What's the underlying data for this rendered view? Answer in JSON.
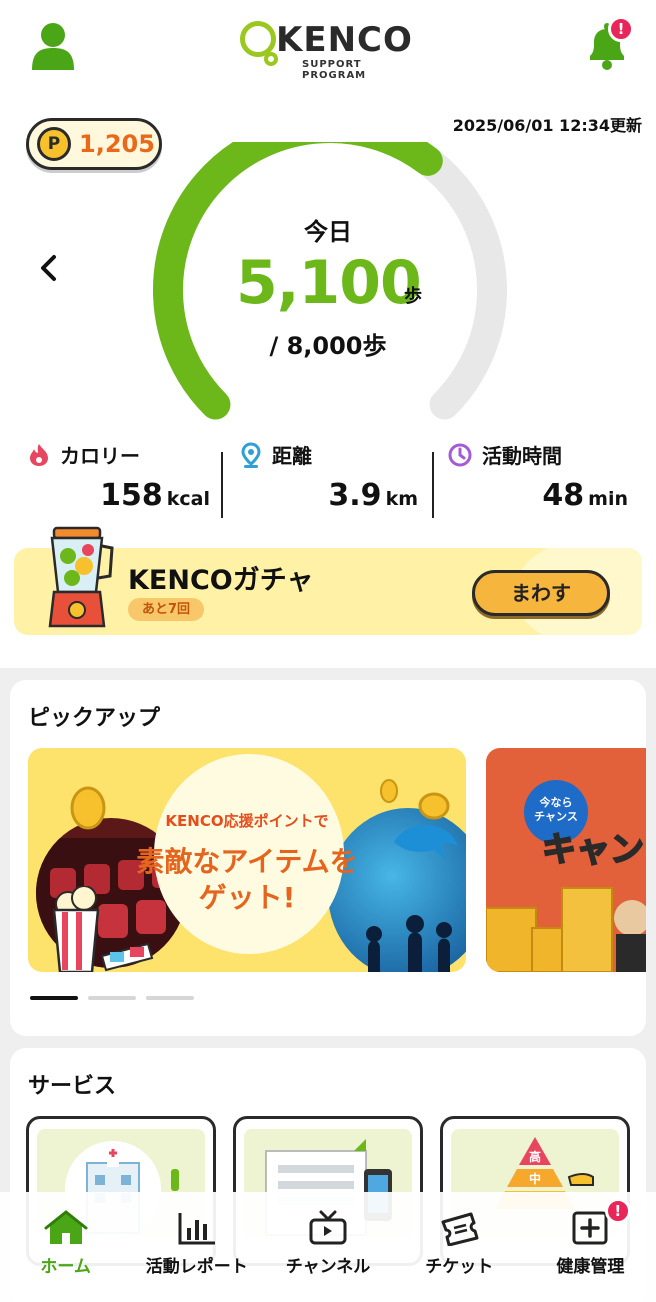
{
  "header": {
    "logo_text": "KENCO",
    "logo_subtitle": "SUPPORT PROGRAM",
    "notification_badge": "!",
    "accent_color": "#6cb81a"
  },
  "status": {
    "points": "1,205",
    "updated": "2025/06/01 12:34更新"
  },
  "steps": {
    "label": "今日",
    "value": "5,100",
    "unit": "歩",
    "goal": "/ 8,000歩",
    "progress": 0.6375
  },
  "stats": {
    "calorie": {
      "label": "カロリー",
      "value": "158",
      "unit": "kcal",
      "icon": "flame-icon",
      "color": "#e8455e"
    },
    "distance": {
      "label": "距離",
      "value": "3.9",
      "unit": "km",
      "icon": "location-pin-icon",
      "color": "#2f9fd6"
    },
    "activity": {
      "label": "活動時間",
      "value": "48",
      "unit": "min",
      "icon": "clock-icon",
      "color": "#a35bd6"
    }
  },
  "gacha": {
    "title": "KENCOガチャ",
    "remaining": "あと7回",
    "button": "まわす"
  },
  "pickup": {
    "title": "ピックアップ",
    "banner1_sub": "KENCO応援ポイントで",
    "banner1_main_1": "素敵なアイテムを",
    "banner1_main_2": "ゲット!",
    "banner2_badge_1": "今なら",
    "banner2_badge_2": "チャンス",
    "banner2_text": "キャン"
  },
  "services": {
    "title": "サービス",
    "item3_top": "高",
    "item3_mid": "中"
  },
  "nav": {
    "home": "ホーム",
    "report": "活動レポート",
    "channel": "チャンネル",
    "ticket": "チケット",
    "health": "健康管理",
    "health_badge": "!"
  }
}
